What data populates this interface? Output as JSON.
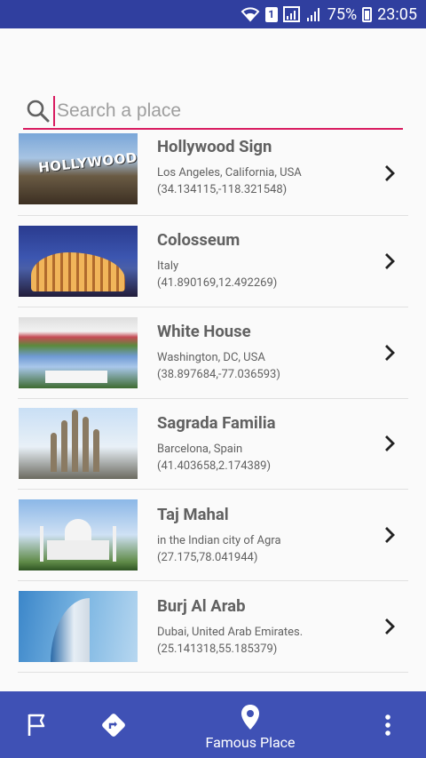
{
  "status_bar": {
    "sim_label": "1",
    "battery": "75%",
    "time": "23:05"
  },
  "search": {
    "placeholder": "Search a place",
    "value": ""
  },
  "places": [
    {
      "name": "Hollywood Sign",
      "location": "Los Angeles, California, USA",
      "coords": "(34.134115,-118.321548)",
      "thumb_text": "HOLLYWOOD"
    },
    {
      "name": "Colosseum",
      "location": "Italy",
      "coords": "(41.890169,12.492269)"
    },
    {
      "name": "White House",
      "location": "Washington, DC, USA",
      "coords": "(38.897684,-77.036593)"
    },
    {
      "name": "Sagrada Familia",
      "location": "Barcelona, Spain",
      "coords": "(41.403658,2.174389)"
    },
    {
      "name": "Taj Mahal",
      "location": "in the Indian city of Agra",
      "coords": "(27.175,78.041944)"
    },
    {
      "name": "Burj Al Arab",
      "location": "Dubai, United Arab Emirates.",
      "coords": "(25.141318,55.185379)"
    }
  ],
  "bottom_nav": {
    "active_label": "Famous Place",
    "items": [
      "flag-icon",
      "directions-icon",
      "place-pin-icon",
      "more-vert-icon"
    ]
  },
  "colors": {
    "primary": "#3f51b5",
    "primary_dark": "#303f9f",
    "accent": "#d81b60"
  }
}
